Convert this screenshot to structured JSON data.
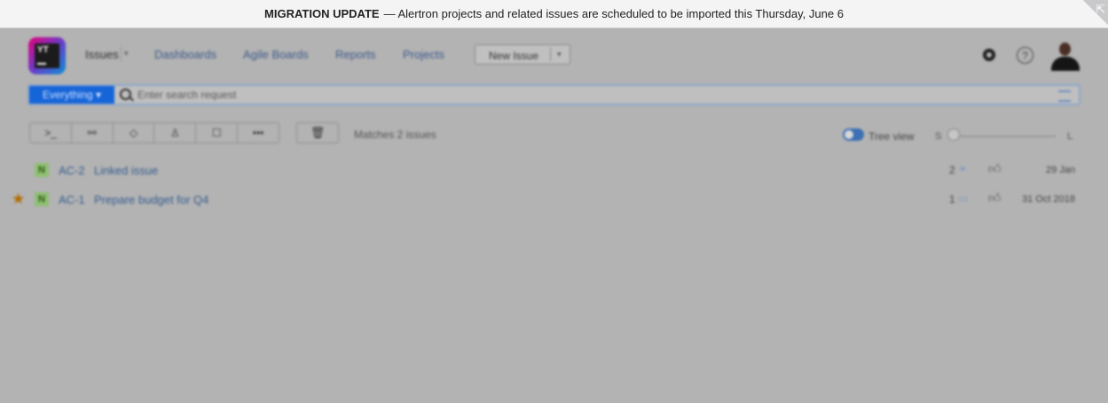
{
  "banner": {
    "title": "MIGRATION UPDATE",
    "message": "— Alertron projects and related issues are scheduled to be imported this Thursday, June 6",
    "corner_icon": "external-link-icon"
  },
  "header": {
    "logo_text": "YT",
    "nav": {
      "issues": "Issues",
      "dashboards": "Dashboards",
      "agile_boards": "Agile Boards",
      "reports": "Reports",
      "projects": "Projects"
    },
    "new_issue_label": "New Issue",
    "help_glyph": "?"
  },
  "search": {
    "scope_label": "Everything",
    "placeholder": "Enter search request"
  },
  "toolbar": {
    "matches": "Matches 2 issues",
    "tree_view_label": "Tree view",
    "tree_view_on": false,
    "size_small": "S",
    "size_large": "L",
    "size_level": 0,
    "buttons": [
      "command-icon",
      "link-icon",
      "tag-icon",
      "assignee-icon",
      "edit-icon",
      "more-icon"
    ],
    "delete_icon": "trash-icon"
  },
  "issues": [
    {
      "starred": false,
      "state": "N",
      "id": "AC-2",
      "title": "Linked issue",
      "count": "2",
      "count_icon": "link-icon",
      "date": "29 Jan"
    },
    {
      "starred": true,
      "state": "N",
      "id": "AC-1",
      "title": "Prepare budget for Q4",
      "count": "1",
      "count_icon": "comment-icon",
      "date": "31 Oct 2018"
    }
  ],
  "colors": {
    "accent": "#1665d8",
    "link": "#365c90",
    "state_new": "#8fbf73",
    "star": "#b36b00"
  }
}
